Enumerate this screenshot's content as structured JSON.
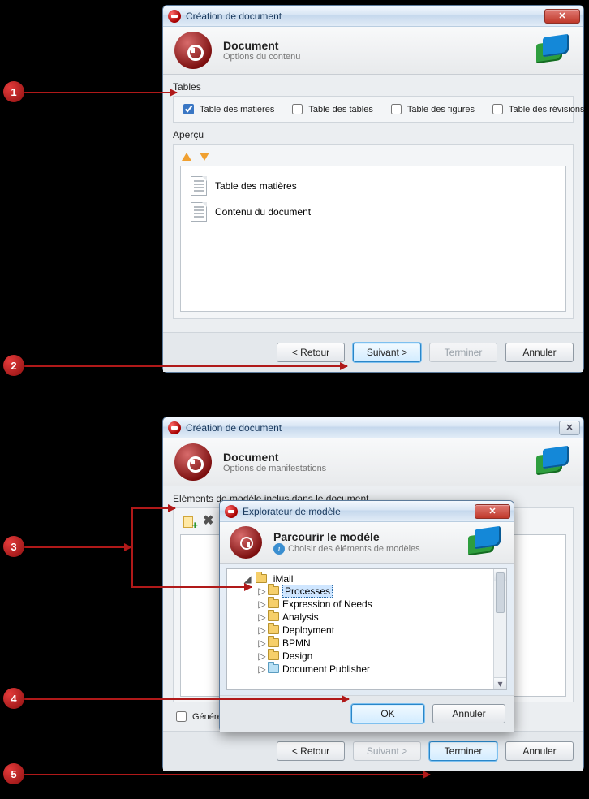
{
  "win1": {
    "title": "Création de document",
    "banner_title": "Document",
    "banner_sub": "Options du contenu",
    "tables_label": "Tables",
    "checks": {
      "toc": "Table des matières",
      "tables": "Table des tables",
      "figures": "Table des figures",
      "revisions": "Table des révisions"
    },
    "apercu_label": "Aperçu",
    "preview": {
      "row1": "Table des matières",
      "row2": "Contenu du document"
    },
    "buttons": {
      "back": "< Retour",
      "next": "Suivant >",
      "finish": "Terminer",
      "cancel": "Annuler"
    }
  },
  "win2": {
    "title": "Création de document",
    "banner_title": "Document",
    "banner_sub": "Options de manifestations",
    "section_label": "Eléments de modèle inclus dans le document",
    "generate_label": "Génére",
    "buttons": {
      "back": "< Retour",
      "next": "Suivant >",
      "finish": "Terminer",
      "cancel": "Annuler"
    }
  },
  "modal": {
    "title": "Explorateur de modèle",
    "banner_title": "Parcourir le modèle",
    "banner_sub": "Choisir des éléments de modèles",
    "tree": {
      "root": "iMail",
      "items": [
        "Processes",
        "Expression of Needs",
        "Analysis",
        "Deployment",
        "BPMN",
        "Design",
        "Document Publisher"
      ]
    },
    "ok": "OK",
    "cancel": "Annuler"
  },
  "callouts": {
    "c1": "1",
    "c2": "2",
    "c3": "3",
    "c4": "4",
    "c5": "5"
  }
}
